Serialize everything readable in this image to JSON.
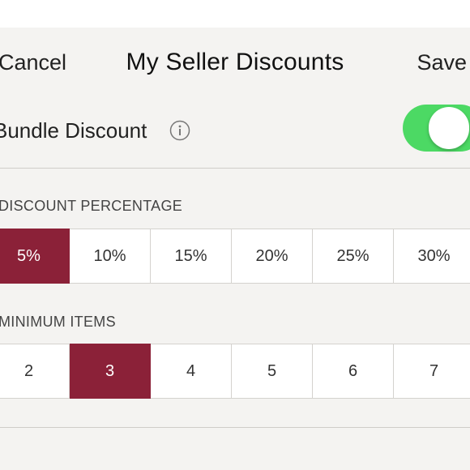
{
  "nav": {
    "cancel_label": "Cancel",
    "title": "My Seller Discounts",
    "save_label": "Save"
  },
  "bundle": {
    "label": "Bundle Discount",
    "info_icon": "info-icon",
    "toggle_on": true
  },
  "discount_percentage": {
    "label": "DISCOUNT PERCENTAGE",
    "options": [
      "5%",
      "10%",
      "15%",
      "20%",
      "25%",
      "30%"
    ],
    "selected": "5%"
  },
  "minimum_items": {
    "label": "MINIMUM ITEMS",
    "options": [
      "2",
      "3",
      "4",
      "5",
      "6",
      "7"
    ],
    "selected": "3"
  },
  "colors": {
    "accent": "#8b2138",
    "toggle_on": "#4cd964",
    "background": "#f4f3f1"
  }
}
